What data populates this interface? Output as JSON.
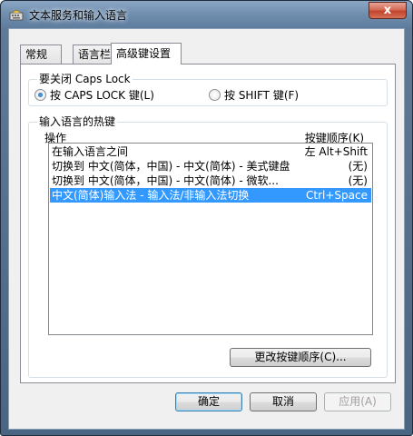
{
  "window": {
    "title": "文本服务和输入语言",
    "close_label": "x"
  },
  "tabs": [
    {
      "label": "常规",
      "active": false
    },
    {
      "label": "语言栏",
      "active": false
    },
    {
      "label": "高级键设置",
      "active": true
    }
  ],
  "caps_lock": {
    "group_label": "要关闭 Caps Lock",
    "options": [
      {
        "label": "按 CAPS LOCK 键(L)",
        "checked": true
      },
      {
        "label": "按 SHIFT 键(F)",
        "checked": false
      }
    ]
  },
  "hotkeys": {
    "group_label": "输入语言的热键",
    "col_action": "操作",
    "col_sequence": "按键顺序(K)",
    "rows": [
      {
        "action": "在输入语言之间",
        "keys": "左 Alt+Shift",
        "selected": false
      },
      {
        "action": "切换到 中文(简体，中国) - 中文(简体) - 美式键盘",
        "keys": "(无)",
        "selected": false
      },
      {
        "action": "切换到 中文(简体，中国) - 中文(简体) - 微软...",
        "keys": "(无)",
        "selected": false
      },
      {
        "action": "中文(简体)输入法 - 输入法/非输入法切换",
        "keys": "Ctrl+Space",
        "selected": true
      }
    ],
    "change_button": "更改按键顺序(C)..."
  },
  "footer": {
    "ok": "确定",
    "cancel": "取消",
    "apply": "应用(A)"
  }
}
